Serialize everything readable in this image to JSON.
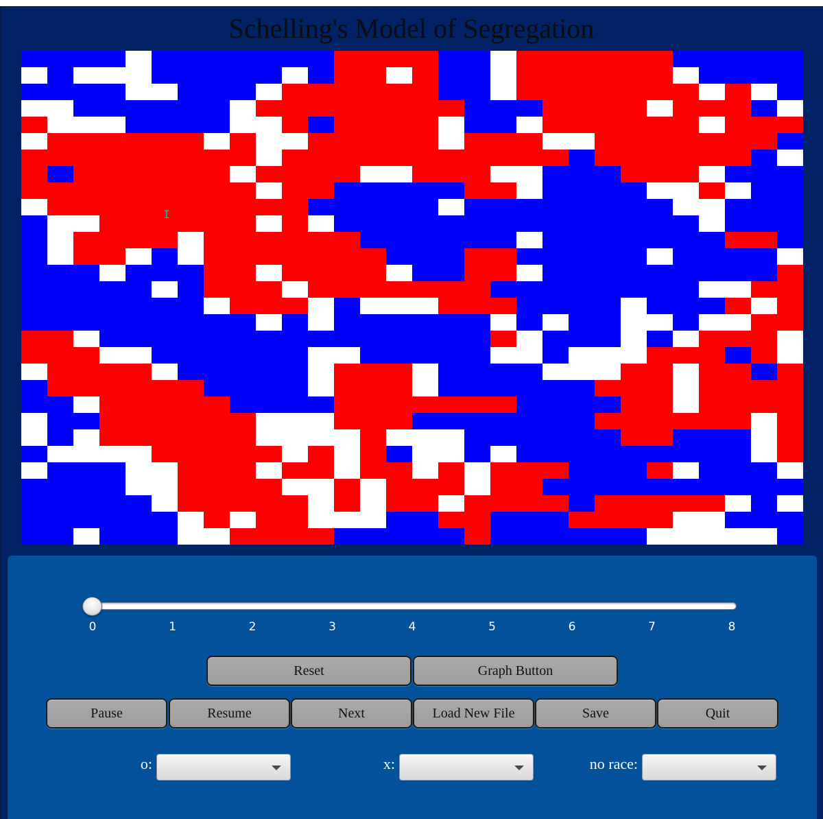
{
  "window": {
    "title": "Schelling's Model of Segregation"
  },
  "colors": {
    "red": "#ff0000",
    "blue": "#0000ff",
    "white": "#ffffff",
    "background": "#012264",
    "panel": "#03519a"
  },
  "grid": {
    "rows": [
      "BBBBWBBBBBBBRRRRBBWRRRRRRBBBBB",
      "WBWWWBBBBBWBRRWRBBWRRRRRRWBBBB",
      "BBBBWWBBBWRRRRRRBBWRRRRRRRWRWB",
      "WWBBBBBBWRRRRRRRRBBBRRRRWRRRBW",
      "RWWWBBBBWWRBRRRRWBBWRRRRRRWRRR",
      "WRRRRRRWRWWRRRRRWRRRWWRRRRRRRB",
      "RRRRRRRRRWRRRRRRRRRRRBRRRRRRBW",
      "RBRRRRRRWRRRRWWRRRWWBBBRRRWBBB",
      "RRRRRRRRRWRRBBBBBRRWBBBBWWRWBB",
      "WRRRRRRRRRRBBBBBWBBBBBBBBWWBBB",
      "BWWRRRRRRWRWBBBBBBBBBBBBBBWBBB",
      "BWRRRRWRRRRRRBBBBBBWBBBBBBBRRB",
      "BWRRWBWRRRRRRRBBBRRBBBBBWBBBBW",
      "BBBWBBBRRWRRRRWBBRRWBBBBBBBBBR",
      "BBBBBWBRRRWRRRRRRRBBBBBBBBWWRR",
      "BBBBBBBWRRRWBWWWRRRBBBBWBBBRWR",
      "BBBBBBBBBWBWBBBBBBWBWBBWWBWWRR",
      "RRWBBBBBBBBBBBBBBBRWBBBWBWRRRW",
      "RRRWWBBBBBBWWBBBBBWWBWWWRRRBRW",
      "WRRRRWBBBBBWRRRWBBBBWWWRRWRRBR",
      "BRRRRRRBBBBWRRRWBBBBBBRRRWRRRR",
      "BBWRRRRRBBBBRRRRRRRBBBBRRWRRRR",
      "WBBRRRRRRWWWRRRBBBBBBBRRRRRRWR",
      "WBWRRRRRRWWWWRWWWBBBBBBRRBBBWR",
      "BWWWWRRRRRWRWRBWWBWBBBBBBBBBWR",
      "WBBBWWRRRWRRWRRWRWRRRBBBRWBBBW",
      "BBBBWWRRRRWWRWRRRWRRBBBBBBBBBB",
      "BBBBBWRRRRRWRWRRWRRRRBRRRRRWBW",
      "BBBBBBWRWRRWWWBBRRBBBRRRRWWBBB",
      "BBWBBBWWRRRRBBBBBRBBBBBBWWWWWB"
    ]
  },
  "slider": {
    "value": 0,
    "min": 0,
    "max": 8,
    "ticks": [
      "0",
      "1",
      "2",
      "3",
      "4",
      "5",
      "6",
      "7",
      "8"
    ]
  },
  "buttons": {
    "reset": "Reset",
    "graph": "Graph Button",
    "pause": "Pause",
    "resume": "Resume",
    "next": "Next",
    "load": "Load New File",
    "save": "Save",
    "quit": "Quit"
  },
  "selectors": {
    "o": {
      "label": "o:",
      "value": ""
    },
    "x": {
      "label": "x:",
      "value": ""
    },
    "norace": {
      "label": "no race:",
      "value": ""
    }
  }
}
